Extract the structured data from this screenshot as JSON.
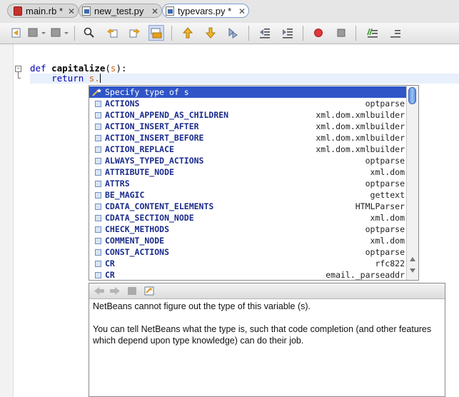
{
  "tabs": [
    {
      "label": "main.rb *",
      "icon": "ruby-file-icon",
      "active": false
    },
    {
      "label": "new_test.py",
      "icon": "python-file-icon",
      "active": false
    },
    {
      "label": "typevars.py *",
      "icon": "python-file-icon",
      "active": true
    }
  ],
  "tab_close_glyph": "✕",
  "toolbar": {
    "buttons": [
      "last-edit-icon",
      "back-icon",
      "forward-icon",
      "find-icon",
      "find-previous-icon",
      "find-next-icon",
      "toggle-highlight-icon",
      "previous-bookmark-icon",
      "next-bookmark-icon",
      "toggle-bookmark-icon",
      "shift-left-icon",
      "shift-right-icon",
      "start-macro-icon",
      "stop-macro-icon",
      "comment-icon",
      "uncomment-icon"
    ]
  },
  "editor": {
    "line1": {
      "kw": "def",
      "name": "capitalize",
      "open": "(",
      "param": "s",
      "close": "):"
    },
    "line2": {
      "kw": "return",
      "text": "s."
    },
    "fold_glyph": "−"
  },
  "completion": {
    "header": "Specify type of s",
    "items": [
      {
        "name": "ACTIONS",
        "module": "optparse"
      },
      {
        "name": "ACTION_APPEND_AS_CHILDREN",
        "module": "xml.dom.xmlbuilder"
      },
      {
        "name": "ACTION_INSERT_AFTER",
        "module": "xml.dom.xmlbuilder"
      },
      {
        "name": "ACTION_INSERT_BEFORE",
        "module": "xml.dom.xmlbuilder"
      },
      {
        "name": "ACTION_REPLACE",
        "module": "xml.dom.xmlbuilder"
      },
      {
        "name": "ALWAYS_TYPED_ACTIONS",
        "module": "optparse"
      },
      {
        "name": "ATTRIBUTE_NODE",
        "module": "xml.dom"
      },
      {
        "name": "ATTRS",
        "module": "optparse"
      },
      {
        "name": "BE_MAGIC",
        "module": "gettext"
      },
      {
        "name": "CDATA_CONTENT_ELEMENTS",
        "module": "HTMLParser"
      },
      {
        "name": "CDATA_SECTION_NODE",
        "module": "xml.dom"
      },
      {
        "name": "CHECK_METHODS",
        "module": "optparse"
      },
      {
        "name": "COMMENT_NODE",
        "module": "xml.dom"
      },
      {
        "name": "CONST_ACTIONS",
        "module": "optparse"
      },
      {
        "name": "CR",
        "module": "rfc822"
      },
      {
        "name": "CR",
        "module": "email._parseaddr"
      }
    ]
  },
  "documentation": {
    "toolbar": [
      "doc-back-icon",
      "doc-forward-icon",
      "doc-stop-icon",
      "doc-open-source-icon"
    ],
    "paragraph1": "NetBeans cannot figure out the type of this variable (s).",
    "paragraph2": "You can tell NetBeans what the type is, such that code completion (and other features which depend upon type knowledge) can do their job."
  },
  "colors": {
    "selection": "#2f55c7",
    "keyword": "#0000b3",
    "parameter": "#c9641b",
    "completion_name": "#1a2b8c"
  }
}
